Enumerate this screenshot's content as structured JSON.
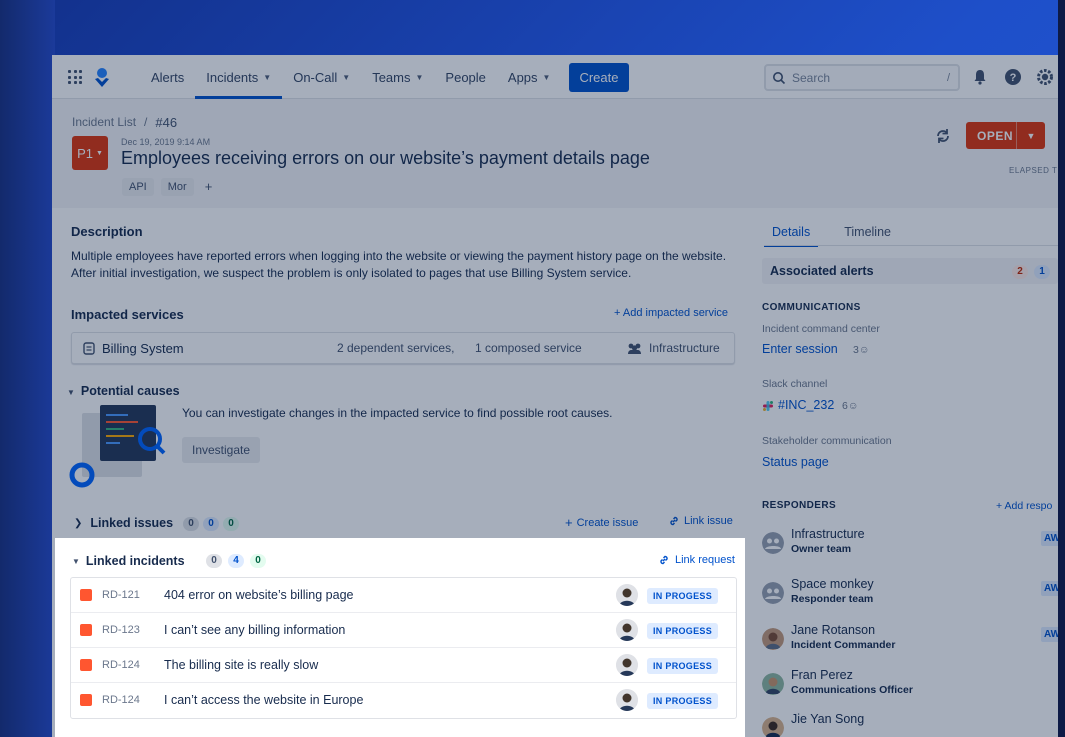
{
  "nav": {
    "items": [
      {
        "label": "Alerts",
        "dropdown": false,
        "active": false
      },
      {
        "label": "Incidents",
        "dropdown": true,
        "active": true
      },
      {
        "label": "On-Call",
        "dropdown": true,
        "active": false
      },
      {
        "label": "Teams",
        "dropdown": true,
        "active": false
      },
      {
        "label": "People",
        "dropdown": false,
        "active": false
      },
      {
        "label": "Apps",
        "dropdown": true,
        "active": false
      }
    ],
    "create_label": "Create",
    "search_placeholder": "Search",
    "search_shortcut": "/"
  },
  "header": {
    "breadcrumb_parent": "Incident List",
    "breadcrumb_sep": "/",
    "breadcrumb_current": "#46",
    "priority": "P1",
    "date": "Dec 19, 2019 9:14 AM",
    "title": "Employees receiving errors on our website’s payment details page",
    "tags": [
      "API",
      "Mor"
    ],
    "add_tag": "+",
    "status_label": "OPEN",
    "elapsed_label": "ELAPSED T"
  },
  "description": {
    "heading": "Description",
    "text": "Multiple employees have reported errors when logging into the website or viewing the payment history page on the website. After initial investigation, we suspect the problem is only isolated to pages that use Billing System service."
  },
  "impacted": {
    "heading": "Impacted services",
    "add_link": "+ Add impacted service",
    "service_name": "Billing System",
    "dependent": "2 dependent services,",
    "composed": "1 composed service",
    "team": "Infrastructure"
  },
  "causes": {
    "heading": "Potential causes",
    "text": "You can investigate changes in the impacted service to find possible root causes.",
    "button": "Investigate"
  },
  "linked_issues": {
    "heading": "Linked issues",
    "counts": [
      "0",
      "0",
      "0"
    ],
    "create": "Create issue",
    "link": "Link issue"
  },
  "linked_incidents": {
    "heading": "Linked incidents",
    "counts": [
      "0",
      "4",
      "0"
    ],
    "link": "Link request",
    "rows": [
      {
        "id": "RD-121",
        "title": "404 error on website’s billing page",
        "status": "IN PROGESS"
      },
      {
        "id": "RD-123",
        "title": "I can’t see any billing information",
        "status": "IN PROGESS"
      },
      {
        "id": "RD-124",
        "title": "The billing site is really slow",
        "status": "IN PROGESS"
      },
      {
        "id": "RD-124",
        "title": "I can’t access the website in Europe",
        "status": "IN PROGESS"
      }
    ]
  },
  "sidebar": {
    "tabs": [
      "Details",
      "Timeline"
    ],
    "assoc_label": "Associated alerts",
    "assoc_counts": [
      "2",
      "1"
    ],
    "communications_head": "COMMUNICATIONS",
    "icc_label": "Incident command center",
    "icc_link": "Enter session",
    "icc_count": "3",
    "slack_label": "Slack channel",
    "slack_link": "#INC_232",
    "slack_count": "6",
    "stake_label": "Stakeholder communication",
    "stake_link": "Status page",
    "responders_head": "RESPONDERS",
    "add_responder": "+ Add respo",
    "responders": [
      {
        "name": "Infrastructure",
        "role": "Owner team",
        "badge": "AW"
      },
      {
        "name": "Space monkey",
        "role": "Responder team",
        "badge": "AW"
      },
      {
        "name": "Jane Rotanson",
        "role": "Incident Commander",
        "badge": "AW"
      },
      {
        "name": "Fran Perez",
        "role": "Communications Officer",
        "badge": ""
      },
      {
        "name": "Jie Yan Song",
        "role": "",
        "badge": ""
      }
    ]
  },
  "colors": {
    "accent": "#0052cc",
    "danger": "#de350b",
    "backdrop": "#1e4fc9"
  }
}
